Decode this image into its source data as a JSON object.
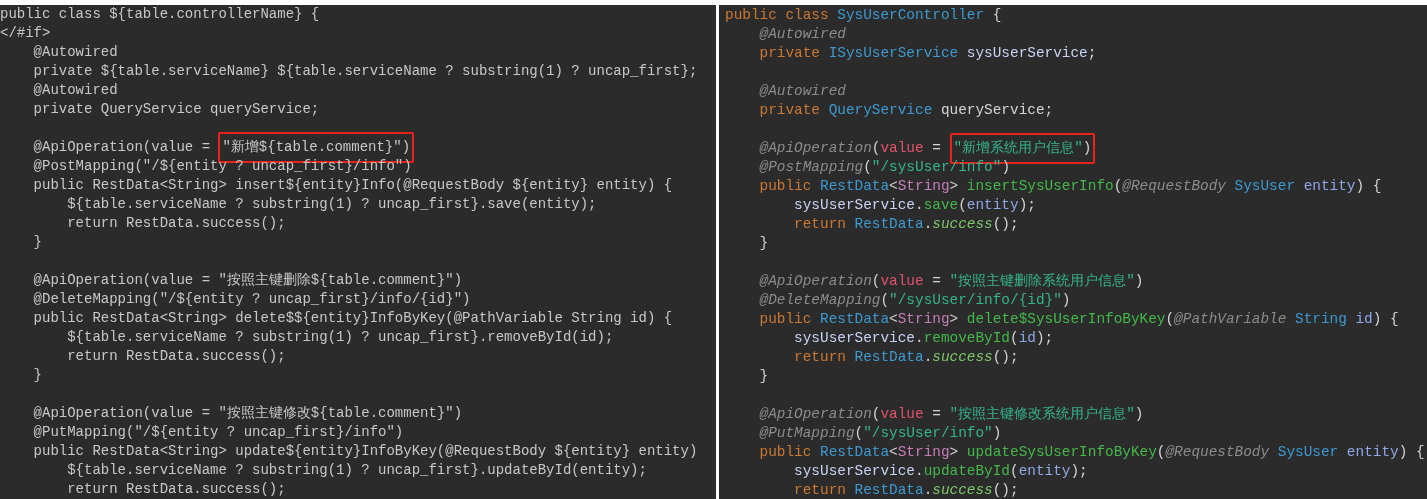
{
  "panels": [
    {
      "kind": "template",
      "lines": [
        {
          "kind": "code",
          "segments": [
            {
              "text": "public class ${table.controllerName} {",
              "kind": "plain"
            }
          ]
        },
        {
          "kind": "code",
          "segments": [
            {
              "text": "</#if>",
              "kind": "plain"
            }
          ]
        },
        {
          "kind": "code",
          "segments": [
            {
              "text": "    @Autowired",
              "kind": "plain"
            }
          ]
        },
        {
          "kind": "code",
          "segments": [
            {
              "text": "    private ${table.serviceName} ${table.serviceName ? substring(1) ? uncap_first};",
              "kind": "plain"
            }
          ]
        },
        {
          "kind": "code",
          "segments": [
            {
              "text": "    @Autowired",
              "kind": "plain"
            }
          ]
        },
        {
          "kind": "code",
          "segments": [
            {
              "text": "    private QueryService queryService;",
              "kind": "plain"
            }
          ]
        },
        {
          "kind": "blank"
        },
        {
          "kind": "code",
          "segments": [
            {
              "text": "    @ApiOperation(value = ",
              "kind": "plain"
            },
            {
              "text": "\"新增${table.comment}\")",
              "kind": "plain",
              "boxed": true
            }
          ]
        },
        {
          "kind": "code",
          "segments": [
            {
              "text": "    @PostMapping(\"/${entity ? uncap_first}/info\")",
              "kind": "plain"
            }
          ]
        },
        {
          "kind": "code",
          "segments": [
            {
              "text": "    public RestData<String> insert${entity}Info(@RequestBody ${entity} entity) {",
              "kind": "plain"
            }
          ]
        },
        {
          "kind": "code",
          "segments": [
            {
              "text": "        ${table.serviceName ? substring(1) ? uncap_first}.save(entity);",
              "kind": "plain"
            }
          ]
        },
        {
          "kind": "code",
          "segments": [
            {
              "text": "        return RestData.success();",
              "kind": "plain"
            }
          ]
        },
        {
          "kind": "code",
          "segments": [
            {
              "text": "    }",
              "kind": "plain"
            }
          ]
        },
        {
          "kind": "blank"
        },
        {
          "kind": "code",
          "segments": [
            {
              "text": "    @ApiOperation(value = \"按照主键删除${table.comment}\")",
              "kind": "plain"
            }
          ]
        },
        {
          "kind": "code",
          "segments": [
            {
              "text": "    @DeleteMapping(\"/${entity ? uncap_first}/info/{id}\")",
              "kind": "plain"
            }
          ]
        },
        {
          "kind": "code",
          "segments": [
            {
              "text": "    public RestData<String> delete$${entity}InfoByKey(@PathVariable String id) {",
              "kind": "plain"
            }
          ]
        },
        {
          "kind": "code",
          "segments": [
            {
              "text": "        ${table.serviceName ? substring(1) ? uncap_first}.removeById(id);",
              "kind": "plain"
            }
          ]
        },
        {
          "kind": "code",
          "segments": [
            {
              "text": "        return RestData.success();",
              "kind": "plain"
            }
          ]
        },
        {
          "kind": "code",
          "segments": [
            {
              "text": "    }",
              "kind": "plain"
            }
          ]
        },
        {
          "kind": "blank"
        },
        {
          "kind": "code",
          "segments": [
            {
              "text": "    @ApiOperation(value = \"按照主键修改${table.comment}\")",
              "kind": "plain"
            }
          ]
        },
        {
          "kind": "code",
          "segments": [
            {
              "text": "    @PutMapping(\"/${entity ? uncap_first}/info\")",
              "kind": "plain"
            }
          ]
        },
        {
          "kind": "code",
          "segments": [
            {
              "text": "    public RestData<String> update${entity}InfoByKey(@RequestBody ${entity} entity)",
              "kind": "plain"
            }
          ]
        },
        {
          "kind": "code",
          "segments": [
            {
              "text": "        ${table.serviceName ? substring(1) ? uncap_first}.updateById(entity);",
              "kind": "plain"
            }
          ]
        },
        {
          "kind": "code",
          "segments": [
            {
              "text": "        return RestData.success();",
              "kind": "plain"
            }
          ]
        }
      ]
    },
    {
      "kind": "generated",
      "lines": [
        {
          "kind": "code",
          "segments": [
            {
              "text": "public class ",
              "kind": "keyword"
            },
            {
              "text": "SysUserController",
              "kind": "type"
            },
            {
              "text": " {",
              "kind": "plain"
            }
          ]
        },
        {
          "kind": "code",
          "segments": [
            {
              "text": "    @Autowired",
              "kind": "annotation"
            }
          ]
        },
        {
          "kind": "code",
          "segments": [
            {
              "text": "    private ",
              "kind": "keyword"
            },
            {
              "text": "ISysUserService",
              "kind": "type"
            },
            {
              "text": " sysUserService",
              "kind": "field"
            },
            {
              "text": ";",
              "kind": "plain"
            }
          ]
        },
        {
          "kind": "blank"
        },
        {
          "kind": "code",
          "segments": [
            {
              "text": "    @Autowired",
              "kind": "annotation"
            }
          ]
        },
        {
          "kind": "code",
          "segments": [
            {
              "text": "    private ",
              "kind": "keyword"
            },
            {
              "text": "QueryService",
              "kind": "type"
            },
            {
              "text": " queryService;",
              "kind": "plain"
            }
          ]
        },
        {
          "kind": "blank"
        },
        {
          "kind": "code",
          "segments": [
            {
              "text": "    @ApiOperation",
              "kind": "annotation"
            },
            {
              "text": "(",
              "kind": "plain"
            },
            {
              "text": "value",
              "kind": "attribute"
            },
            {
              "text": " = ",
              "kind": "plain"
            },
            {
              "text": "\"新增系统用户信息\"",
              "kind": "string",
              "boxed": true
            },
            {
              "text": ")",
              "kind": "plain",
              "boxed": true
            }
          ]
        },
        {
          "kind": "code",
          "segments": [
            {
              "text": "    @PostMapping",
              "kind": "annotation"
            },
            {
              "text": "(",
              "kind": "plain"
            },
            {
              "text": "\"/sysUser/info\"",
              "kind": "string"
            },
            {
              "text": ")",
              "kind": "plain"
            }
          ]
        },
        {
          "kind": "code",
          "segments": [
            {
              "text": "    public ",
              "kind": "keyword"
            },
            {
              "text": "RestData",
              "kind": "type"
            },
            {
              "text": "<",
              "kind": "plain"
            },
            {
              "text": "String",
              "kind": "generic"
            },
            {
              "text": "> ",
              "kind": "plain"
            },
            {
              "text": "insertSysUserInfo",
              "kind": "method"
            },
            {
              "text": "(",
              "kind": "plain"
            },
            {
              "text": "@RequestBody",
              "kind": "annotation"
            },
            {
              "text": " SysUser",
              "kind": "type"
            },
            {
              "text": " entity",
              "kind": "variable"
            },
            {
              "text": ") {",
              "kind": "plain"
            }
          ]
        },
        {
          "kind": "code",
          "segments": [
            {
              "text": "        sysUserService",
              "kind": "field"
            },
            {
              "text": ".",
              "kind": "plain"
            },
            {
              "text": "save",
              "kind": "method"
            },
            {
              "text": "(",
              "kind": "plain"
            },
            {
              "text": "entity",
              "kind": "variable"
            },
            {
              "text": ");",
              "kind": "plain"
            }
          ]
        },
        {
          "kind": "code",
          "segments": [
            {
              "text": "        return ",
              "kind": "keyword"
            },
            {
              "text": "RestData",
              "kind": "type"
            },
            {
              "text": ".",
              "kind": "plain"
            },
            {
              "text": "success",
              "kind": "static"
            },
            {
              "text": "();",
              "kind": "plain"
            }
          ]
        },
        {
          "kind": "code",
          "segments": [
            {
              "text": "    }",
              "kind": "plain"
            }
          ]
        },
        {
          "kind": "blank"
        },
        {
          "kind": "code",
          "segments": [
            {
              "text": "    @ApiOperation",
              "kind": "annotation"
            },
            {
              "text": "(",
              "kind": "plain"
            },
            {
              "text": "value",
              "kind": "attribute"
            },
            {
              "text": " = ",
              "kind": "plain"
            },
            {
              "text": "\"按照主键删除系统用户信息\"",
              "kind": "string"
            },
            {
              "text": ")",
              "kind": "plain"
            }
          ]
        },
        {
          "kind": "code",
          "segments": [
            {
              "text": "    @DeleteMapping",
              "kind": "annotation"
            },
            {
              "text": "(",
              "kind": "plain"
            },
            {
              "text": "\"/sysUser/info/{id}\"",
              "kind": "string"
            },
            {
              "text": ")",
              "kind": "plain"
            }
          ]
        },
        {
          "kind": "code",
          "segments": [
            {
              "text": "    public ",
              "kind": "keyword"
            },
            {
              "text": "RestData",
              "kind": "type"
            },
            {
              "text": "<",
              "kind": "plain"
            },
            {
              "text": "String",
              "kind": "generic"
            },
            {
              "text": "> ",
              "kind": "plain"
            },
            {
              "text": "delete$SysUserInfoByKey",
              "kind": "method"
            },
            {
              "text": "(",
              "kind": "plain"
            },
            {
              "text": "@PathVariable",
              "kind": "annotation"
            },
            {
              "text": " String",
              "kind": "type"
            },
            {
              "text": " id",
              "kind": "variable"
            },
            {
              "text": ") {",
              "kind": "plain"
            }
          ]
        },
        {
          "kind": "code",
          "segments": [
            {
              "text": "        sysUserService",
              "kind": "field"
            },
            {
              "text": ".",
              "kind": "plain"
            },
            {
              "text": "removeById",
              "kind": "method"
            },
            {
              "text": "(",
              "kind": "plain"
            },
            {
              "text": "id",
              "kind": "variable"
            },
            {
              "text": ");",
              "kind": "plain"
            }
          ]
        },
        {
          "kind": "code",
          "segments": [
            {
              "text": "        return ",
              "kind": "keyword"
            },
            {
              "text": "RestData",
              "kind": "type"
            },
            {
              "text": ".",
              "kind": "plain"
            },
            {
              "text": "success",
              "kind": "static"
            },
            {
              "text": "();",
              "kind": "plain"
            }
          ]
        },
        {
          "kind": "code",
          "segments": [
            {
              "text": "    }",
              "kind": "plain"
            }
          ]
        },
        {
          "kind": "blank"
        },
        {
          "kind": "code",
          "segments": [
            {
              "text": "    @ApiOperation",
              "kind": "annotation"
            },
            {
              "text": "(",
              "kind": "plain"
            },
            {
              "text": "value",
              "kind": "attribute"
            },
            {
              "text": " = ",
              "kind": "plain"
            },
            {
              "text": "\"按照主键修改系统用户信息\"",
              "kind": "string"
            },
            {
              "text": ")",
              "kind": "plain"
            }
          ]
        },
        {
          "kind": "code",
          "segments": [
            {
              "text": "    @PutMapping",
              "kind": "annotation"
            },
            {
              "text": "(",
              "kind": "plain"
            },
            {
              "text": "\"/sysUser/info\"",
              "kind": "string"
            },
            {
              "text": ")",
              "kind": "plain"
            }
          ]
        },
        {
          "kind": "code",
          "segments": [
            {
              "text": "    public ",
              "kind": "keyword"
            },
            {
              "text": "RestData",
              "kind": "type"
            },
            {
              "text": "<",
              "kind": "plain"
            },
            {
              "text": "String",
              "kind": "generic"
            },
            {
              "text": "> ",
              "kind": "plain"
            },
            {
              "text": "updateSysUserInfoByKey",
              "kind": "method"
            },
            {
              "text": "(",
              "kind": "plain"
            },
            {
              "text": "@RequestBody",
              "kind": "annotation"
            },
            {
              "text": " SysUser",
              "kind": "type"
            },
            {
              "text": " entity",
              "kind": "variable"
            },
            {
              "text": ") {",
              "kind": "plain"
            }
          ]
        },
        {
          "kind": "code",
          "segments": [
            {
              "text": "        sysUserService",
              "kind": "field"
            },
            {
              "text": ".",
              "kind": "plain"
            },
            {
              "text": "updateById",
              "kind": "method"
            },
            {
              "text": "(",
              "kind": "plain"
            },
            {
              "text": "entity",
              "kind": "variable"
            },
            {
              "text": ");",
              "kind": "plain"
            }
          ]
        },
        {
          "kind": "code",
          "segments": [
            {
              "text": "        return ",
              "kind": "keyword"
            },
            {
              "text": "RestData",
              "kind": "type"
            },
            {
              "text": ".",
              "kind": "plain"
            },
            {
              "text": "success",
              "kind": "static"
            },
            {
              "text": "();",
              "kind": "plain"
            }
          ]
        }
      ]
    }
  ]
}
